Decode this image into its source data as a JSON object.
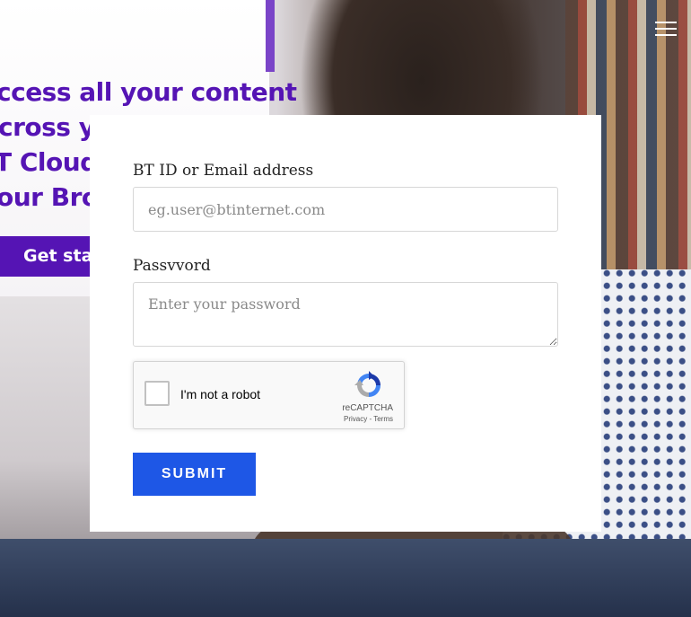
{
  "promo": {
    "lines": [
      "ccess all your content",
      "cross yo",
      "T Cloud",
      "our Broc"
    ],
    "cta_label": "Get star"
  },
  "menu": {
    "icon": "hamburger-icon"
  },
  "form": {
    "email": {
      "label": "BT ID or Email address",
      "placeholder": "eg.user@btinternet.com",
      "value": ""
    },
    "password": {
      "label": "Passvvord",
      "placeholder": "Enter your password",
      "value": ""
    },
    "recaptcha": {
      "label": "I'm not a robot",
      "brand": "reCAPTCHA",
      "privacy": "Privacy",
      "separator": " - ",
      "terms": "Terms",
      "checked": false
    },
    "submit_label": "SUBMIT"
  },
  "colors": {
    "brand_purple": "#5514b4",
    "submit_blue": "#1e57e6",
    "card_bg": "#ffffff"
  }
}
